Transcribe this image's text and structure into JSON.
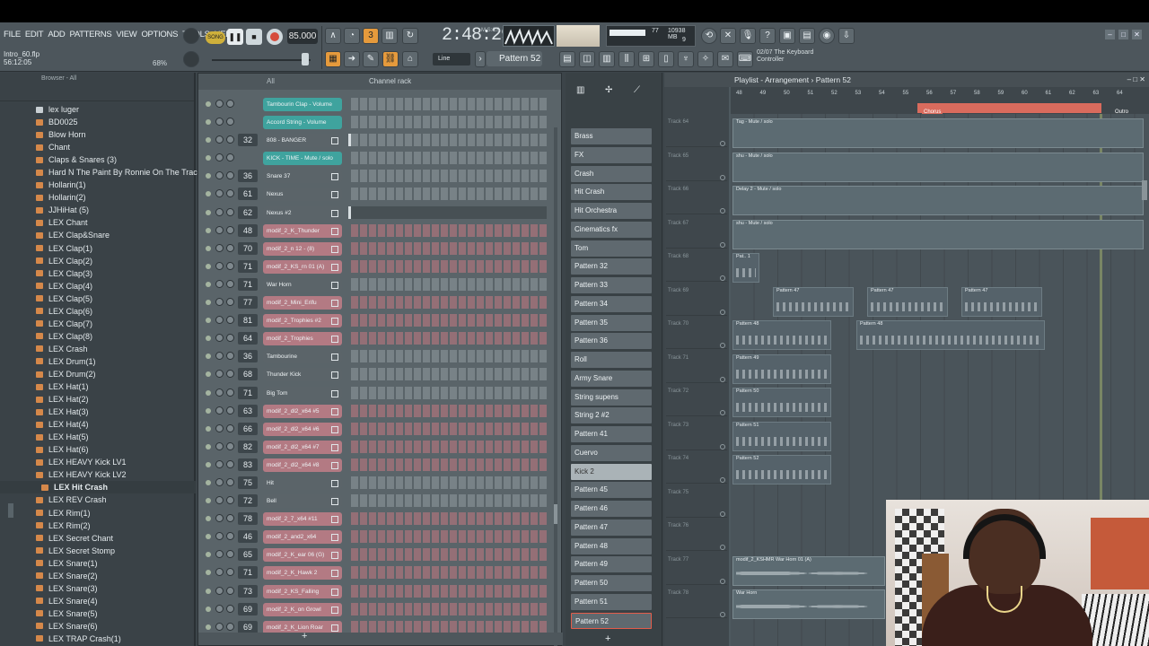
{
  "toolbar": {
    "menu": [
      "FILE",
      "EDIT",
      "ADD",
      "PATTERNS",
      "VIEW",
      "OPTIONS",
      "TOOLS",
      "HELP"
    ],
    "project_file": "Intro_60.flp",
    "project_time": "56:12:05",
    "pct": "68%",
    "song_mode": "SONG",
    "tempo": "85.000",
    "time": "2:48:29",
    "time_unit": "M:S:CS",
    "cpu": "77",
    "ram": "10938 MB",
    "polyphony": "9",
    "pattern": "Pattern 52",
    "snap": "Line",
    "hint_line1": "02/07",
    "hint_title": "The Keyboard",
    "hint_line2": "Controller"
  },
  "browser": {
    "header": "Browser - All",
    "items": [
      "lex luger",
      "BD0025",
      "Blow Horn",
      "Chant",
      "Claps & Snares (3)",
      "Hard N The Paint By Ronnie On The Track",
      "Hollarin(1)",
      "Hollarin(2)",
      "JJHiHat (5)",
      "LEX Chant",
      "LEX Clap&Snare",
      "LEX Clap(1)",
      "LEX Clap(2)",
      "LEX Clap(3)",
      "LEX Clap(4)",
      "LEX Clap(5)",
      "LEX Clap(6)",
      "LEX Clap(7)",
      "LEX Clap(8)",
      "LEX Crash",
      "LEX Drum(1)",
      "LEX Drum(2)",
      "LEX Hat(1)",
      "LEX Hat(2)",
      "LEX Hat(3)",
      "LEX Hat(4)",
      "LEX Hat(5)",
      "LEX Hat(6)",
      "LEX HEAVY Kick LV1",
      "LEX HEAVY Kick LV2",
      "LEX Hit Crash",
      "LEX REV Crash",
      "LEX Rim(1)",
      "LEX Rim(2)",
      "LEX Secret Chant",
      "LEX Secret Stomp",
      "LEX Snare(1)",
      "LEX Snare(2)",
      "LEX Snare(3)",
      "LEX Snare(4)",
      "LEX Snare(5)",
      "LEX Snare(6)",
      "LEX TRAP Crash(1)"
    ]
  },
  "rack": {
    "title": "Channel rack",
    "filter": "All",
    "channels": [
      {
        "num": "",
        "name": "Tambourin Clap - Volume",
        "color": "teal"
      },
      {
        "num": "",
        "name": "Accord String - Volume",
        "color": "teal"
      },
      {
        "num": "32",
        "name": "808 - BANGER",
        "color": "gray"
      },
      {
        "num": "",
        "name": "KICK - TIME - Mute / solo",
        "color": "teal"
      },
      {
        "num": "36",
        "name": "Snare 37",
        "color": "gray"
      },
      {
        "num": "61",
        "name": "Nexus",
        "color": "gray"
      },
      {
        "num": "62",
        "name": "Nexus #2",
        "color": "gray"
      },
      {
        "num": "48",
        "name": "modif_2_K_Thunder",
        "color": "pink"
      },
      {
        "num": "70",
        "name": "modif_2_n 12 - (8)",
        "color": "pink"
      },
      {
        "num": "71",
        "name": "modif_2_KS_rn 01 (A)",
        "color": "pink"
      },
      {
        "num": "71",
        "name": "War Horn",
        "color": "gray"
      },
      {
        "num": "77",
        "name": "modif_2_Mini_Erifu",
        "color": "pink"
      },
      {
        "num": "81",
        "name": "modif_2_Trophies #2",
        "color": "pink"
      },
      {
        "num": "64",
        "name": "modif_2_Trophies",
        "color": "pink"
      },
      {
        "num": "36",
        "name": "Tambourine",
        "color": "gray"
      },
      {
        "num": "68",
        "name": "Thunder Kick",
        "color": "gray"
      },
      {
        "num": "71",
        "name": "Big Tom",
        "color": "gray"
      },
      {
        "num": "63",
        "name": "modif_2_dl2_x64 #5",
        "color": "pink"
      },
      {
        "num": "66",
        "name": "modif_2_dl2_x64 #6",
        "color": "pink"
      },
      {
        "num": "82",
        "name": "modif_2_dl2_x64 #7",
        "color": "pink"
      },
      {
        "num": "83",
        "name": "modif_2_dl2_x64 #8",
        "color": "pink"
      },
      {
        "num": "75",
        "name": "Hit",
        "color": "gray"
      },
      {
        "num": "72",
        "name": "Bell",
        "color": "gray"
      },
      {
        "num": "78",
        "name": "modif_2_7_x64 #11",
        "color": "pink"
      },
      {
        "num": "46",
        "name": "modif_2_and2_x64",
        "color": "pink"
      },
      {
        "num": "65",
        "name": "modif_2_K_ear 06 (G)",
        "color": "pink"
      },
      {
        "num": "71",
        "name": "modif_2_K_Hawk 2",
        "color": "pink"
      },
      {
        "num": "73",
        "name": "modif_2_KS_Falling",
        "color": "pink"
      },
      {
        "num": "69",
        "name": "modif_2_K_on Growl",
        "color": "pink"
      },
      {
        "num": "69",
        "name": "modif_2_K_Lion Roar",
        "color": "pink"
      }
    ]
  },
  "patterns": [
    "Brass",
    "FX",
    "Crash",
    "Hit Crash",
    "Hit Orchestra",
    "Cinematics fx",
    "Tom",
    "Pattern 32",
    "Pattern 33",
    "Pattern 34",
    "Pattern 35",
    "Pattern 36",
    "Roll",
    "Army Snare",
    "String supens",
    "String 2 #2",
    "Pattern 41",
    "Cuervo",
    "Kick 2",
    "Pattern 45",
    "Pattern 46",
    "Pattern 47",
    "Pattern 48",
    "Pattern 49",
    "Pattern 50",
    "Pattern 51",
    "Pattern 52"
  ],
  "playlist": {
    "title": "Playlist - Arrangement",
    "current": "Pattern 52",
    "bars": [
      "48",
      "49",
      "50",
      "51",
      "52",
      "53",
      "54",
      "55",
      "56",
      "57",
      "58",
      "59",
      "60",
      "61",
      "62",
      "63",
      "64"
    ],
    "markers": {
      "chorus": "Chorus",
      "outro": "Outro"
    },
    "tracks": [
      "Track 64",
      "Track 65",
      "Track 66",
      "Track 67",
      "Track 68",
      "Track 69",
      "Track 70",
      "Track 71",
      "Track 72",
      "Track 73",
      "Track 74",
      "Track 75",
      "Track 76",
      "Track 77",
      "Track 78"
    ],
    "clips": [
      {
        "label": "Tag - Mute / solo",
        "kind": "auto"
      },
      {
        "label": "shu - Mute / solo",
        "kind": "auto"
      },
      {
        "label": "Delay 2 - Mute / solo",
        "kind": "auto"
      },
      {
        "label": "shu - Mute / solo",
        "kind": "auto"
      },
      {
        "label": "Pat.. 1",
        "kind": "pat"
      },
      {
        "label": "Pattern 47",
        "kind": "pat"
      },
      {
        "label": "Pattern 47",
        "kind": "pat"
      },
      {
        "label": "Pattern 47",
        "kind": "pat"
      },
      {
        "label": "Pattern 48",
        "kind": "pat"
      },
      {
        "label": "Pattern 48",
        "kind": "pat"
      },
      {
        "label": "Pattern 49",
        "kind": "pat"
      },
      {
        "label": "Pattern 50",
        "kind": "pat"
      },
      {
        "label": "Pattern 51",
        "kind": "pat"
      },
      {
        "label": "Pattern 52",
        "kind": "pat"
      },
      {
        "label": "modif_2_KSHMR War Horn 01 (A)",
        "kind": "audio"
      },
      {
        "label": "War Horn",
        "kind": "audio"
      }
    ]
  }
}
